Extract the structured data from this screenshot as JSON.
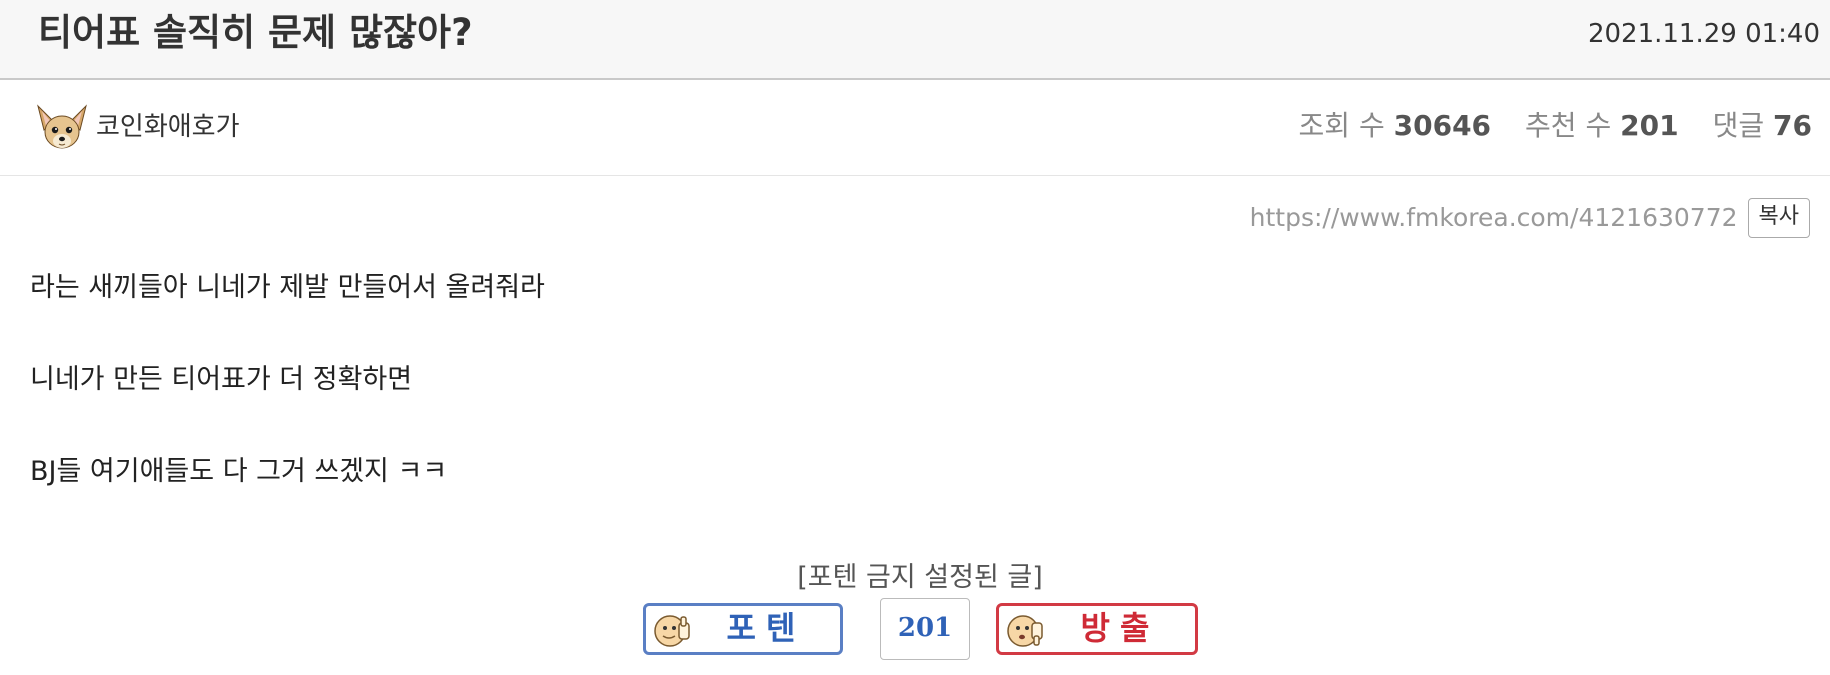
{
  "post": {
    "title": "티어표 솔직히 문제 많잖아?",
    "date": "2021.11.29 01:40",
    "author": "코인화애호가",
    "avatar_icon": "chihuahua-avatar",
    "url": "https://www.fmkorea.com/4121630772",
    "copy_label": "복사",
    "body_lines": [
      "라는 새끼들아 니네가 제발 만들어서 올려줘라",
      "니네가 만든 티어표가 더 정확하면",
      "BJ들 여기애들도 다 그거 쓰겠지 ㅋㅋ"
    ]
  },
  "stats": {
    "views_label": "조회 수",
    "views": "30646",
    "recommend_label": "추천 수",
    "recommend": "201",
    "comments_label": "댓글",
    "comments": "76"
  },
  "vote": {
    "notice": "[포텐 금지 설정된 글]",
    "up_label": "포텐",
    "up_icon": "thumbs-up-face-icon",
    "count": "201",
    "down_label": "방출",
    "down_icon": "thumbs-down-face-icon"
  },
  "colors": {
    "up_accent": "#2f62b7",
    "down_accent": "#cf2a36",
    "title_bg": "#f7f7f7"
  }
}
